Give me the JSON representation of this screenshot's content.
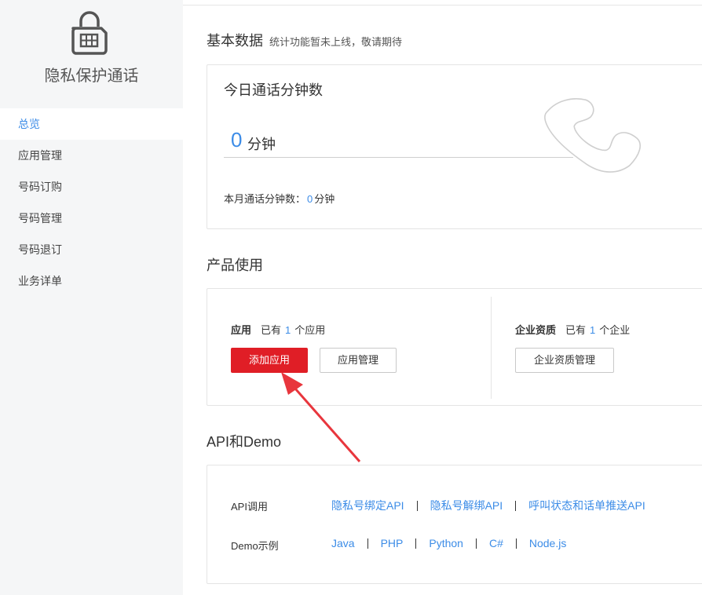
{
  "sidebar": {
    "app_name": "隐私保护通话",
    "items": [
      {
        "label": "总览",
        "active": true
      },
      {
        "label": "应用管理"
      },
      {
        "label": "号码订购"
      },
      {
        "label": "号码管理"
      },
      {
        "label": "号码退订"
      },
      {
        "label": "业务详单"
      }
    ]
  },
  "basic": {
    "title": "基本数据",
    "subtitle": "统计功能暂未上线，敬请期待",
    "card_title": "今日通话分钟数",
    "today_value": "0",
    "today_unit": "分钟",
    "month_label": "本月通话分钟数：",
    "month_value": "0",
    "month_unit": "分钟"
  },
  "product": {
    "title": "产品使用",
    "app_label": "应用",
    "app_prefix": "已有",
    "app_count": "1",
    "app_suffix": "个应用",
    "add_app_button": "添加应用",
    "manage_app_button": "应用管理",
    "ent_label": "企业资质",
    "ent_prefix": "已有",
    "ent_count": "1",
    "ent_suffix": "个企业",
    "ent_manage_button": "企业资质管理"
  },
  "api": {
    "title": "API和Demo",
    "api_label": "API调用",
    "api_links": [
      "隐私号绑定API",
      "隐私号解绑API",
      "呼叫状态和话单推送API"
    ],
    "demo_label": "Demo示例",
    "demo_links": [
      "Java",
      "PHP",
      "Python",
      "C#",
      "Node.js"
    ]
  },
  "colors": {
    "accent": "#3c8ce7",
    "primary_button": "#e01e26",
    "arrow": "#e8363d",
    "sidebar_bg": "#f5f6f7"
  },
  "icons": [
    "sim-card-lock-icon",
    "phone-handset-icon",
    "annotation-arrow"
  ]
}
